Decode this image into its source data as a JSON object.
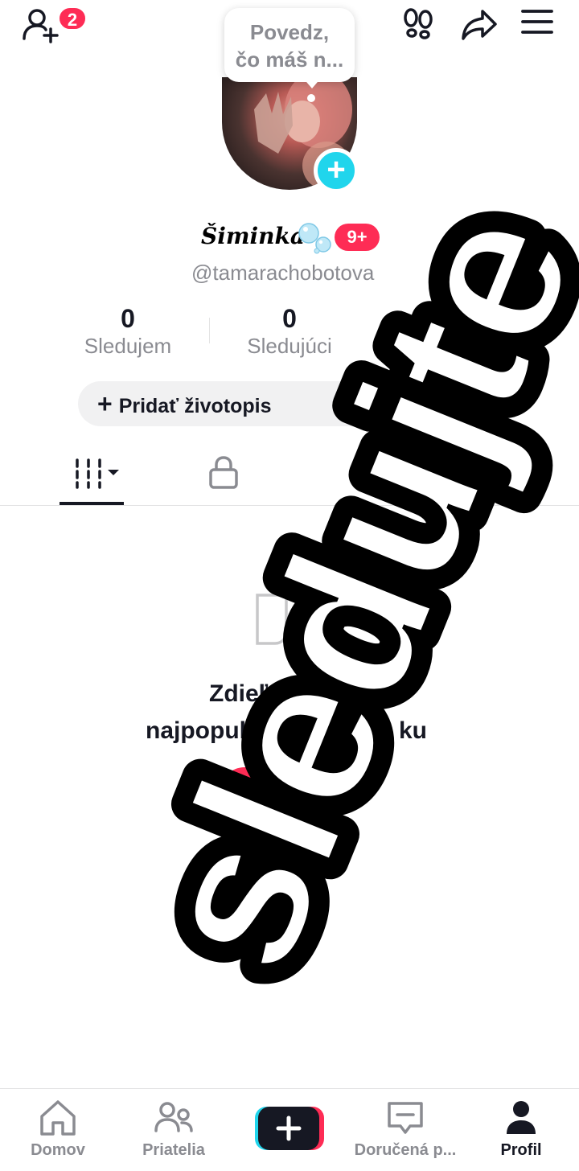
{
  "header": {
    "friend_requests_badge": "2",
    "add_friend_icon": "add-friend-icon",
    "footprints_icon": "footprints-icon",
    "share_icon": "share-icon",
    "menu_icon": "menu-icon"
  },
  "bubble": {
    "line1": "Povedz,",
    "line2": "čo máš n..."
  },
  "profile": {
    "display_name": "Šiminka",
    "name_badge": "9+",
    "username": "@tamarachobotova"
  },
  "stats": [
    {
      "value": "0",
      "label": "Sledujem"
    },
    {
      "value": "0",
      "label": "Sledujúci"
    }
  ],
  "bio_button": {
    "icon": "+",
    "label": "Pridať životopis"
  },
  "tabs": {
    "videos_icon": "grid-icon",
    "private_icon": "lock-icon"
  },
  "empty_state": {
    "line1": "Zdieľaj",
    "line2": "najpopul",
    "line2_end": "ku",
    "cta_letter": "N"
  },
  "overlay_text": "sledujte",
  "nav": {
    "items": [
      {
        "label": "Domov",
        "icon": "home-icon"
      },
      {
        "label": "Priatelia",
        "icon": "friends-icon"
      },
      {
        "label": "",
        "icon": "create-icon"
      },
      {
        "label": "Doručená p...",
        "icon": "inbox-icon"
      },
      {
        "label": "Profil",
        "icon": "profile-icon"
      }
    ]
  },
  "colors": {
    "accent": "#fe2c55",
    "cyan": "#20d5ec",
    "text": "#161823",
    "muted": "#8a8b91"
  }
}
